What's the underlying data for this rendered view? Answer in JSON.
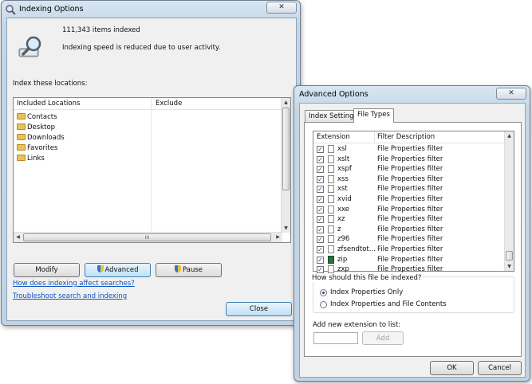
{
  "indexing_window": {
    "title": "Indexing Options",
    "close_label": "✕",
    "items_indexed": "111,343 items indexed",
    "speed_status": "Indexing speed is reduced due to user activity.",
    "locations_heading": "Index these locations:",
    "columns": [
      "Included Locations",
      "Exclude"
    ],
    "locations": [
      "Contacts",
      "Desktop",
      "Downloads",
      "Favorites",
      "Links"
    ],
    "hscroll_grip": "III",
    "buttons": {
      "modify": "Modify",
      "advanced": "Advanced",
      "pause": "Pause",
      "close": "Close"
    },
    "links": {
      "how_affects": "How does indexing affect searches?",
      "troubleshoot": "Troubleshoot search and indexing"
    }
  },
  "advanced_window": {
    "title": "Advanced Options",
    "close_label": "✕",
    "tabs": [
      "Index Settings",
      "File Types"
    ],
    "active_tab": "File Types",
    "columns": [
      "Extension",
      "Filter Description"
    ],
    "file_types": [
      {
        "ext": "xsl",
        "desc": "File Properties filter",
        "checked": true
      },
      {
        "ext": "xslt",
        "desc": "File Properties filter",
        "checked": true
      },
      {
        "ext": "xspf",
        "desc": "File Properties filter",
        "checked": true
      },
      {
        "ext": "xss",
        "desc": "File Properties filter",
        "checked": true
      },
      {
        "ext": "xst",
        "desc": "File Properties filter",
        "checked": true
      },
      {
        "ext": "xvid",
        "desc": "File Properties filter",
        "checked": true
      },
      {
        "ext": "xxe",
        "desc": "File Properties filter",
        "checked": true
      },
      {
        "ext": "xz",
        "desc": "File Properties filter",
        "checked": true
      },
      {
        "ext": "z",
        "desc": "File Properties filter",
        "checked": true
      },
      {
        "ext": "z96",
        "desc": "File Properties filter",
        "checked": true
      },
      {
        "ext": "zfsendtot...",
        "desc": "File Properties filter",
        "checked": true
      },
      {
        "ext": "zip",
        "desc": "File Properties filter",
        "checked": true
      },
      {
        "ext": "zxp",
        "desc": "File Properties filter",
        "checked": true
      }
    ],
    "index_question": "How should this file be indexed?",
    "index_options": [
      "Index Properties Only",
      "Index Properties and File Contents"
    ],
    "selected_option": "Index Properties Only",
    "add_extension_label": "Add new extension to list:",
    "add_extension_value": "",
    "buttons": {
      "add": "Add",
      "ok": "OK",
      "cancel": "Cancel"
    }
  },
  "colors": {
    "link": "#0b55c4",
    "selection": "#cde8ff",
    "title_glass": "#c3d7e8"
  }
}
